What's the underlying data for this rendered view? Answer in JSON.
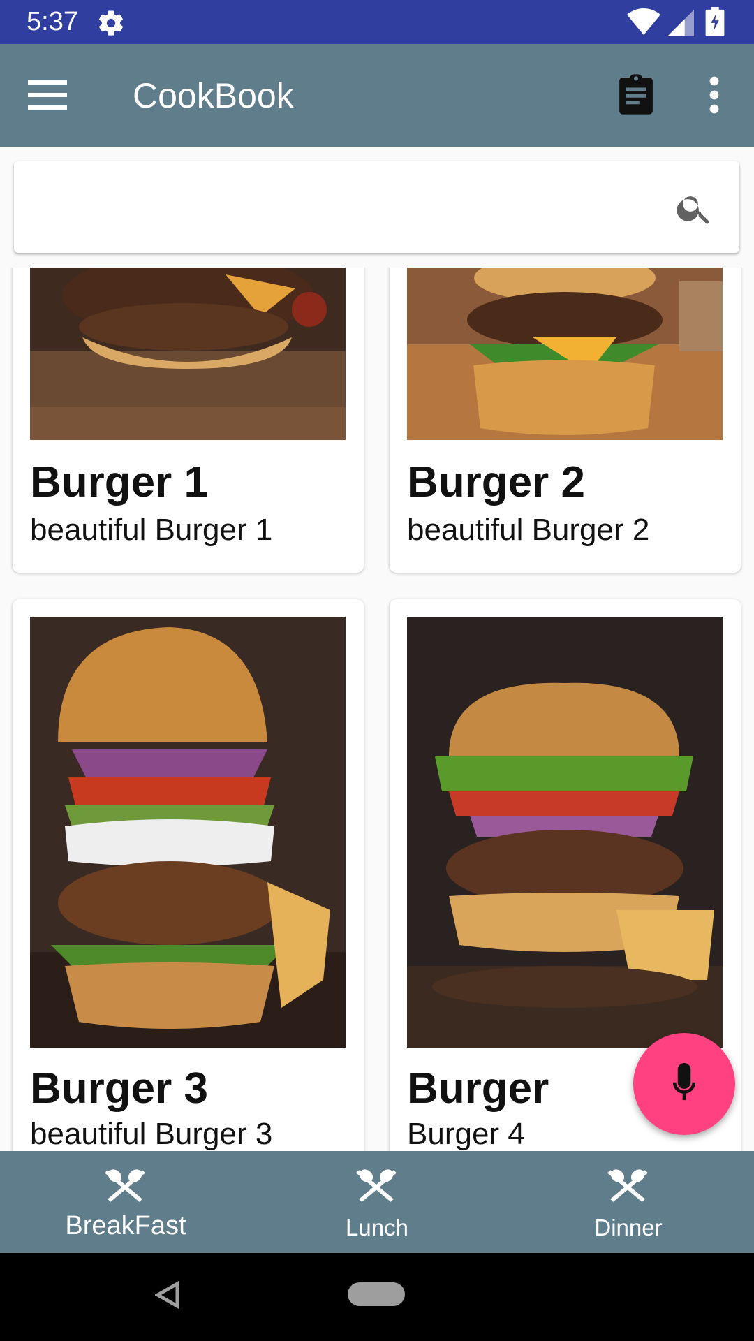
{
  "status_bar": {
    "time": "5:37"
  },
  "app_bar": {
    "title": "CookBook"
  },
  "search": {
    "value": "",
    "placeholder": ""
  },
  "recipes": [
    {
      "name": "Burger 1",
      "description": "beautiful Burger 1"
    },
    {
      "name": "Burger 2",
      "description": "beautiful Burger 2"
    },
    {
      "name": "Burger 3",
      "description": "beautiful Burger 3"
    },
    {
      "name": "Burger",
      "description": "Burger 4"
    }
  ],
  "bottom_nav": {
    "items": [
      {
        "label": "BreakFast",
        "icon": "utensils-icon"
      },
      {
        "label": "Lunch",
        "icon": "utensils-icon"
      },
      {
        "label": "Dinner",
        "icon": "utensils-icon"
      }
    ]
  },
  "fab": {
    "icon": "microphone-icon",
    "color": "#ff4081"
  },
  "colors": {
    "status_bar": "#303f9f",
    "primary": "#607d8b",
    "accent": "#ff4081"
  }
}
